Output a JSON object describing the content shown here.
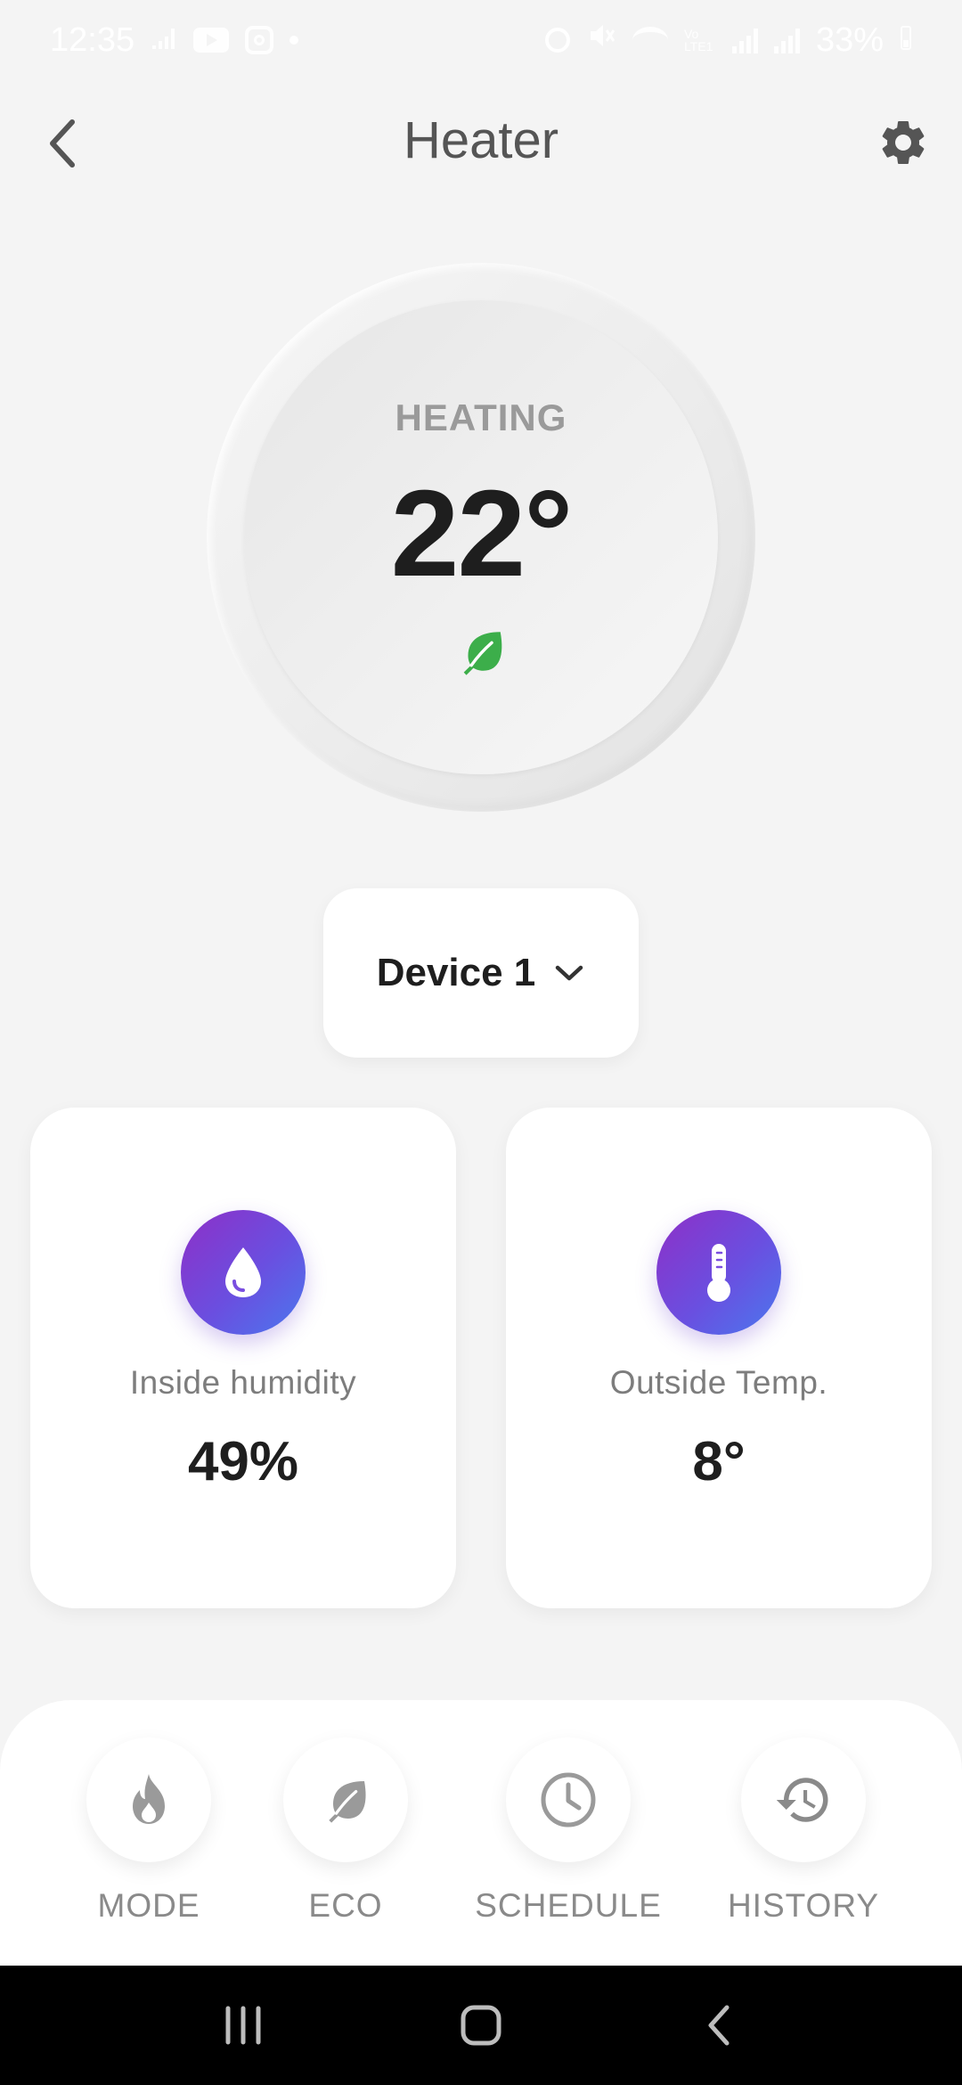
{
  "status_bar": {
    "time": "12:35",
    "battery": "33%",
    "network_label": "Vo LTE1",
    "icons": [
      "wifi-call-icon",
      "youtube-icon",
      "instagram-icon",
      "notification-dot-icon",
      "alarm-icon",
      "mute-icon",
      "wifi-icon",
      "signal-icon",
      "battery-icon"
    ]
  },
  "header": {
    "title": "Heater",
    "back_icon": "chevron-left-icon",
    "settings_icon": "gear-icon"
  },
  "dial": {
    "status": "HEATING",
    "temperature": "22°",
    "eco_icon": "leaf-icon",
    "eco_color": "#3cae4a"
  },
  "device_selector": {
    "selected": "Device 1",
    "icon": "chevron-down-icon"
  },
  "cards": [
    {
      "label": "Inside humidity",
      "value": "49%",
      "icon": "droplet-icon"
    },
    {
      "label": "Outside Temp.",
      "value": "8°",
      "icon": "thermometer-icon"
    }
  ],
  "actions": [
    {
      "label": "MODE",
      "icon": "flame-icon"
    },
    {
      "label": "ECO",
      "icon": "leaf-icon"
    },
    {
      "label": "SCHEDULE",
      "icon": "clock-icon"
    },
    {
      "label": "HISTORY",
      "icon": "history-icon"
    }
  ],
  "nav_bar": {
    "items": [
      "recent-apps-icon",
      "home-icon",
      "back-icon"
    ]
  },
  "colors": {
    "background": "#f4f4f4",
    "accent_gradient_start": "#8e2fc7",
    "accent_gradient_end": "#4a78ee",
    "text_primary": "#1e1e1e",
    "text_secondary": "#8a8a8a"
  }
}
